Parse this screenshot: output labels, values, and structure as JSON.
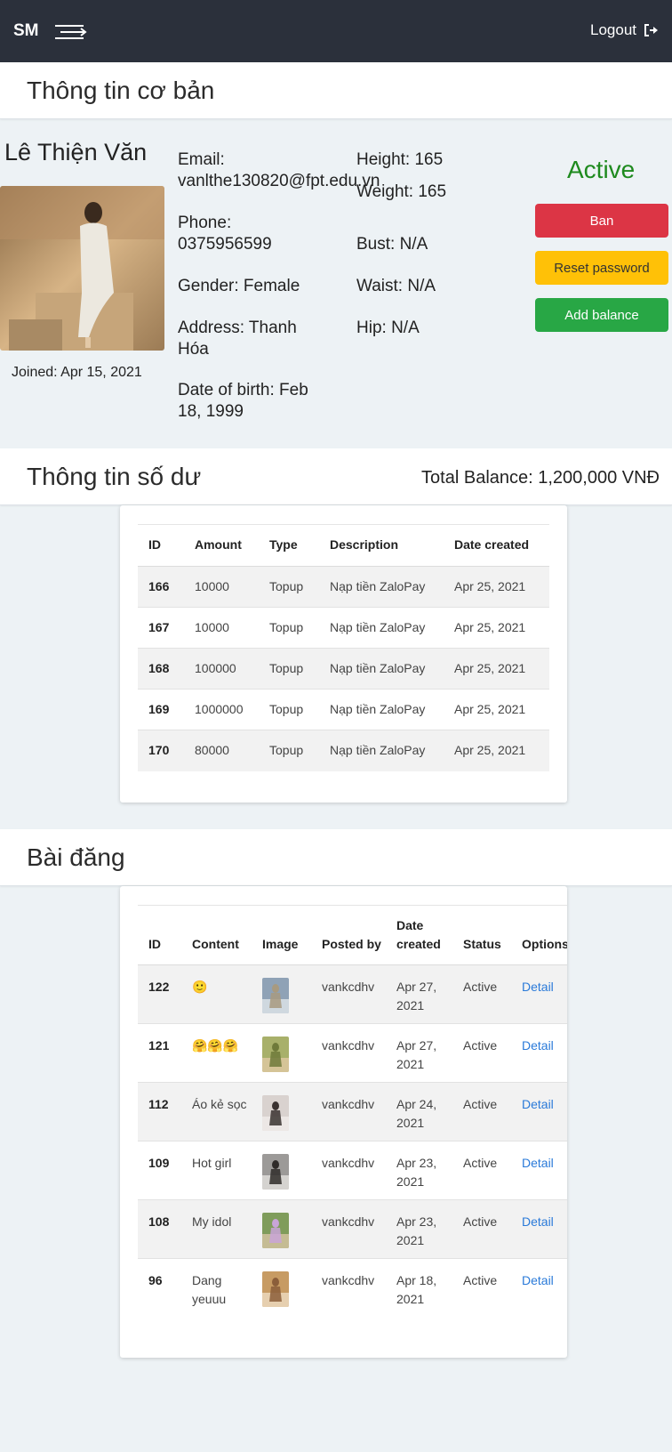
{
  "nav": {
    "brand": "SM",
    "logout": "Logout"
  },
  "basic_section": {
    "title": "Thông tin cơ bản"
  },
  "profile": {
    "name": "Lê Thiện Văn",
    "joined": "Joined: Apr 15, 2021",
    "email": "Email:\nvanlthe130820@fpt.edu.vn",
    "phone": "Phone:\n0375956599",
    "gender": "Gender: Female",
    "address": "Address: Thanh\nHóa",
    "dob": "Date of birth: Feb\n18, 1999",
    "height": "Height: 165",
    "weight": "Weight: 165",
    "bust": "Bust: N/A",
    "waist": "Waist: N/A",
    "hip": "Hip: N/A",
    "status": "Active",
    "status_color": "#1e8a1e"
  },
  "actions": {
    "ban": "Ban",
    "reset": "Reset password",
    "add_balance": "Add balance"
  },
  "balance_section": {
    "title": "Thông tin số dư",
    "total": "Total Balance: 1,200,000 VNĐ"
  },
  "balance_table": {
    "headers": [
      "ID",
      "Amount",
      "Type",
      "Description",
      "Date created"
    ],
    "rows": [
      [
        "166",
        "10000",
        "Topup",
        "Nạp tiền ZaloPay",
        "Apr 25, 2021"
      ],
      [
        "167",
        "10000",
        "Topup",
        "Nạp tiền ZaloPay",
        "Apr 25, 2021"
      ],
      [
        "168",
        "100000",
        "Topup",
        "Nạp tiền ZaloPay",
        "Apr 25, 2021"
      ],
      [
        "169",
        "1000000",
        "Topup",
        "Nạp tiền ZaloPay",
        "Apr 25, 2021"
      ],
      [
        "170",
        "80000",
        "Topup",
        "Nạp tiền ZaloPay",
        "Apr 25, 2021"
      ]
    ]
  },
  "posts_section": {
    "title": "Bài đăng"
  },
  "posts_table": {
    "headers": [
      "ID",
      "Content",
      "Image",
      "Posted by",
      "Date created",
      "Status",
      "Options"
    ],
    "rows": [
      {
        "id": "122",
        "content": "🙂",
        "posted_by": "vankcdhv",
        "date": "Apr 27, 2021",
        "status": "Active",
        "option": "Detail"
      },
      {
        "id": "121",
        "content": "🤗🤗🤗",
        "posted_by": "vankcdhv",
        "date": "Apr 27, 2021",
        "status": "Active",
        "option": "Detail"
      },
      {
        "id": "112",
        "content": "Áo kẻ sọc",
        "posted_by": "vankcdhv",
        "date": "Apr 24, 2021",
        "status": "Active",
        "option": "Detail"
      },
      {
        "id": "109",
        "content": "Hot girl",
        "posted_by": "vankcdhv",
        "date": "Apr 23, 2021",
        "status": "Active",
        "option": "Detail"
      },
      {
        "id": "108",
        "content": "My idol",
        "posted_by": "vankcdhv",
        "date": "Apr 23, 2021",
        "status": "Active",
        "option": "Detail"
      },
      {
        "id": "96",
        "content": "Dang yeuuu",
        "posted_by": "vankcdhv",
        "date": "Apr 18, 2021",
        "status": "Active",
        "option": "Detail"
      }
    ]
  },
  "colors": {
    "navbar": "#2b303b",
    "page_bg": "#edf2f5",
    "ban": "#dc3545",
    "reset": "#ffc107",
    "add_balance": "#28a745",
    "link": "#2a7ad9"
  }
}
